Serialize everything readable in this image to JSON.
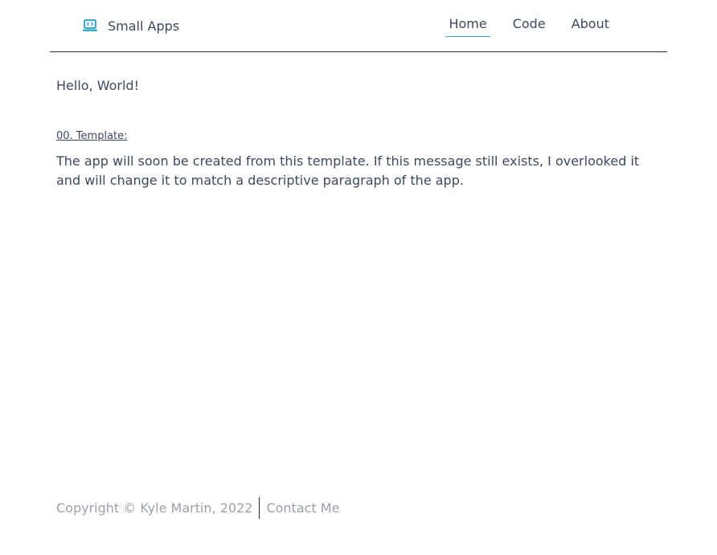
{
  "header": {
    "brand": {
      "icon": "laptop-code-icon",
      "title": "Small Apps",
      "accent_color": "#3aa6c8"
    },
    "nav": {
      "items": [
        {
          "label": "Home",
          "active": true
        },
        {
          "label": "Code",
          "active": false
        },
        {
          "label": "About",
          "active": false
        }
      ]
    }
  },
  "main": {
    "greeting": "Hello, World!",
    "section_title": "00. Template:",
    "description": "The app will soon be created from this template. If this message still exists, I overlooked it and will change it to match a descriptive paragraph of the app."
  },
  "footer": {
    "copyright": "Copyright © Kyle Martin, 2022",
    "contact_label": "Contact Me"
  },
  "colors": {
    "text": "#3d4a5c",
    "muted": "#9aa0ab",
    "accent": "#3aa6c8",
    "divider": "#2b2b2b"
  }
}
